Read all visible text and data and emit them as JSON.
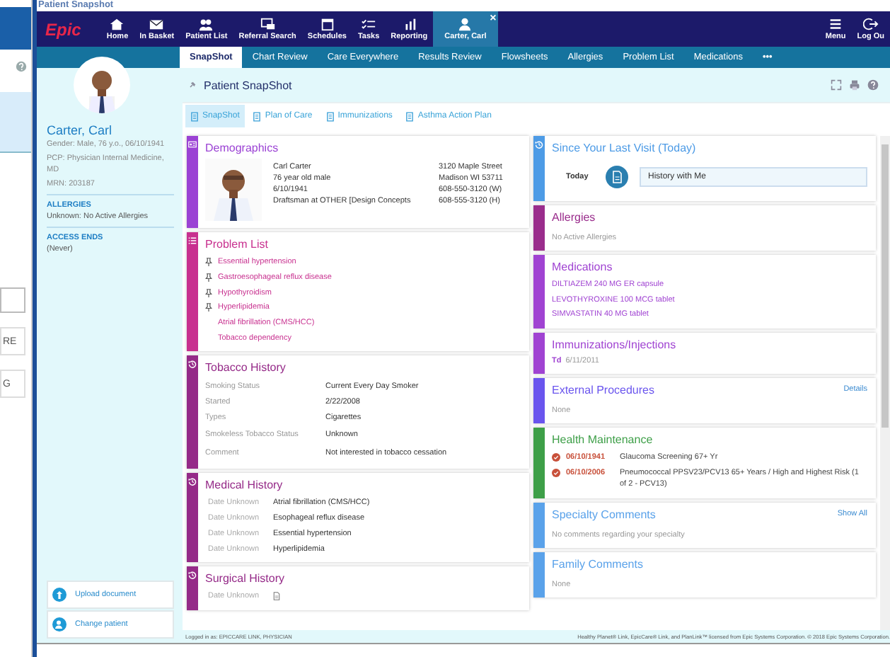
{
  "window_title": "Patient Snapshot",
  "background_window": {
    "texts": [
      "RE",
      "G"
    ]
  },
  "nav": {
    "logo": "Epic",
    "close": "×",
    "items": [
      {
        "label": "Home",
        "selected": false
      },
      {
        "label": "In Basket",
        "selected": false
      },
      {
        "label": "Patient List",
        "selected": false
      },
      {
        "label": "Referral Search",
        "selected": false
      },
      {
        "label": "Schedules",
        "selected": false
      },
      {
        "label": "Tasks",
        "selected": false
      },
      {
        "label": "Reporting",
        "selected": false
      },
      {
        "label": "Carter, Carl",
        "selected": true
      }
    ],
    "right_items": [
      {
        "label": "Menu"
      },
      {
        "label": "Log Ou"
      }
    ]
  },
  "tabs": [
    {
      "label": "SnapShot",
      "selected": true
    },
    {
      "label": "Chart Review",
      "selected": false
    },
    {
      "label": "Care Everywhere",
      "selected": false
    },
    {
      "label": "Results Review",
      "selected": false
    },
    {
      "label": "Flowsheets",
      "selected": false
    },
    {
      "label": "Allergies",
      "selected": false
    },
    {
      "label": "Problem List",
      "selected": false
    },
    {
      "label": "Medications",
      "selected": false
    }
  ],
  "more_tabs": "•••",
  "patient": {
    "name": "Carter, Carl",
    "details": [
      "Gender: Male, 76 y.o., 06/10/1941",
      "PCP: Physician Internal Medicine, MD",
      "MRN: 203187"
    ],
    "sections": [
      {
        "label": "ALLERGIES",
        "value": "Unknown: No Active Allergies"
      },
      {
        "label": "ACCESS ENDS",
        "value": "(Never)"
      }
    ]
  },
  "sidebar_buttons": [
    "Upload document",
    "Change patient"
  ],
  "page_title": "Patient SnapShot",
  "subtabs": [
    {
      "label": "SnapShot",
      "selected": true
    },
    {
      "label": "Plan of Care",
      "selected": false
    },
    {
      "label": "Immunizations",
      "selected": false
    },
    {
      "label": "Asthma Action Plan",
      "selected": false
    }
  ],
  "left_cards": [
    {
      "title": "Demographics",
      "color": "#9b42d4",
      "kind": "demographics",
      "left": [
        "Carl Carter",
        "76 year old male",
        "6/10/1941",
        "Draftsman at OTHER [Design Concepts"
      ],
      "right": [
        "3120 Maple Street",
        "Madison WI 53711",
        "608-550-3120 (W)",
        "608-555-3120 (H)"
      ]
    },
    {
      "title": "Problem List",
      "color": "#c8308f",
      "kind": "list",
      "items": [
        {
          "text": "Essential hypertension",
          "pinned": true
        },
        {
          "text": "Gastroesophageal reflux disease",
          "pinned": true
        },
        {
          "text": "Hypothyroidism",
          "pinned": true
        },
        {
          "text": "Hyperlipidemia",
          "pinned": true
        },
        {
          "text": "Atrial fibrillation (CMS/HCC)",
          "pinned": false
        },
        {
          "text": "Tobacco dependency",
          "pinned": false
        }
      ]
    },
    {
      "title": "Tobacco History",
      "color": "#952a88",
      "kind": "fields",
      "rows": [
        {
          "label": "Smoking Status",
          "value": "Current Every Day Smoker"
        },
        {
          "label": "Started",
          "value": "2/22/2008"
        },
        {
          "label": "Types",
          "value": "Cigarettes"
        },
        {
          "label": "Smokeless Tobacco Status",
          "value": "Unknown"
        },
        {
          "label": "Comment",
          "value": "Not interested in tobacco cessation"
        }
      ]
    },
    {
      "title": "Medical History",
      "color": "#952a88",
      "kind": "dated",
      "rows": [
        {
          "date": "Date Unknown",
          "value": "Atrial fibrillation (CMS/HCC)"
        },
        {
          "date": "Date Unknown",
          "value": "Esophageal reflux disease"
        },
        {
          "date": "Date Unknown",
          "value": "Essential hypertension"
        },
        {
          "date": "Date Unknown",
          "value": "Hyperlipidemia"
        }
      ]
    },
    {
      "title": "Surgical History",
      "color": "#952a88",
      "kind": "dated",
      "rows": [
        {
          "date": "Date Unknown"
        }
      ]
    }
  ],
  "right_cards": [
    {
      "title": "Since Your Last Visit (Today)",
      "color": "#4d9be6",
      "kind": "timeline",
      "label": "Today",
      "entry": "History with Me"
    },
    {
      "title": "Allergies",
      "color": "#9a2d8c",
      "kind": "text",
      "lines": [
        "No Active Allergies"
      ]
    },
    {
      "title": "Medications",
      "color": "#a043d2",
      "kind": "links",
      "lines": [
        "DILTIAZEM 240 MG ER capsule",
        "LEVOTHYROXINE 100 MCG tablet",
        "SIMVASTATIN 40 MG tablet"
      ]
    },
    {
      "title": "Immunizations/Injections",
      "color": "#a043d2",
      "kind": "immunizations",
      "rows": [
        {
          "name": "Td",
          "date": "6/11/2011"
        }
      ]
    },
    {
      "title": "External Procedures",
      "color": "#6a55ee",
      "kind": "text",
      "link": "Details",
      "lines": [
        "None"
      ]
    },
    {
      "title": "Health Maintenance",
      "color": "#3e9f48",
      "kind": "maintenance",
      "rows": [
        {
          "date": "06/10/1941",
          "value": "Glaucoma Screening 67+ Yr"
        },
        {
          "date": "06/10/2006",
          "value": "Pneumococcal PPSV23/PCV13 65+ Years / High and Highest Risk (1 of 2 - PCV13)"
        }
      ]
    },
    {
      "title": "Specialty Comments",
      "color": "#5aa2ea",
      "kind": "text",
      "link": "Show All",
      "lines": [
        "No comments regarding your specialty"
      ]
    },
    {
      "title": "Family Comments",
      "color": "#5aa2ea",
      "kind": "text",
      "lines": [
        "None"
      ]
    }
  ],
  "footer": {
    "login": "Logged in as: EPICCARE LINK, PHYSICIAN",
    "copyright": "Healthy Planet® Link, EpicCare® Link, and PlanLink™ licensed from Epic Systems Corporation. © 2018 Epic Systems Corporation."
  }
}
